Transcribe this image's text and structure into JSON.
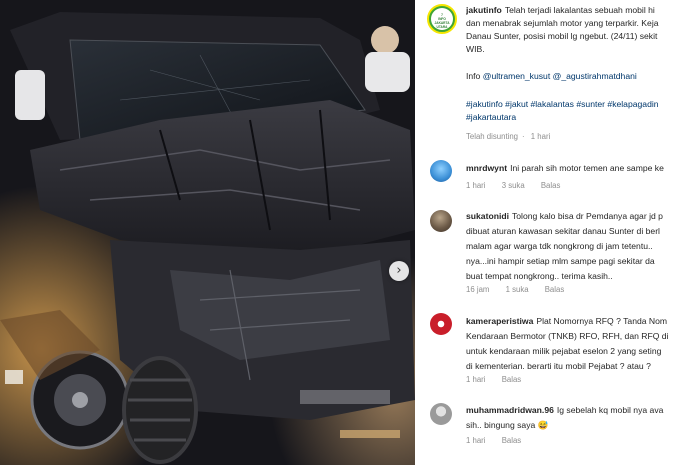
{
  "post": {
    "username": "jakutinfo",
    "avatar_lines": [
      "7",
      "INFO",
      "JAKARTA",
      "UTARA"
    ],
    "caption_lines": [
      "Telah terjadi lakalantas sebuah mobil hi",
      "dan menabrak sejumlah motor yang terparkir. Keja",
      "Danau Sunter, posisi mobil lg ngebut. (24/11) sekit",
      "WIB."
    ],
    "info_prefix": "Info",
    "info_mentions": "@ultramen_kusut @_agustirahmatdhani",
    "hashtags_line1": "#jakutinfo #jakut #lakalantas #sunter #kelapagadin",
    "hashtags_line2": "#jakartautara",
    "edited_label": "Telah disunting",
    "edited_time": "1 hari"
  },
  "carousel": {
    "next_icon": "chevron-right-icon",
    "next_glyph": "›"
  },
  "comments": [
    {
      "username": "mnrdwynt",
      "lines": [
        "Ini parah sih motor temen ane sampe ke"
      ],
      "time": "1 hari",
      "likes": "3 suka",
      "reply": "Balas"
    },
    {
      "username": "sukatonidi",
      "lines": [
        "Tolong kalo bisa dr Pemdanya agar jd p",
        "dibuat aturan kawasan sekitar danau Sunter di berl",
        "malam agar warga tdk nongkrong di jam tetentu..",
        "nya...ini hampir setiap mlm sampe pagi sekitar da",
        "buat tempat nongkrong.. terima kasih.."
      ],
      "time": "16 jam",
      "likes": "1 suka",
      "reply": "Balas"
    },
    {
      "username": "kameraperistiwa",
      "lines": [
        "Plat Nomornya RFQ ? Tanda Nom",
        "Kendaraan Bermotor (TNKB) RFO, RFH, dan RFQ di",
        "untuk kendaraan milik pejabat eselon 2 yang seting",
        "di kementerian. berarti itu mobil Pejabat ? atau ?"
      ],
      "time": "1 hari",
      "likes": "",
      "reply": "Balas"
    },
    {
      "username": "muhammadridwan.96",
      "lines": [
        "Ig sebelah kq mobil nya ava",
        "sih.. bingung saya 😅"
      ],
      "time": "1 hari",
      "likes": "",
      "reply": "Balas"
    }
  ],
  "colors": {
    "text": "#262626",
    "secondary": "#8e8e8e",
    "link": "#00376b",
    "avatar_ring": "#f5e600"
  }
}
